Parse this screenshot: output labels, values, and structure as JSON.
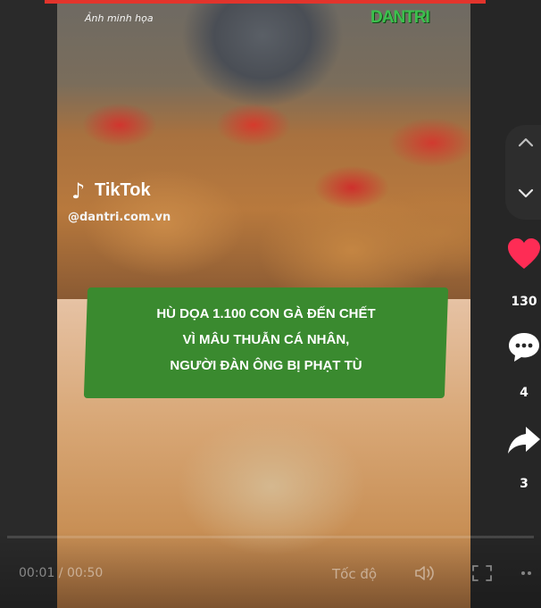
{
  "overlay": {
    "caption": "Ảnh minh họa",
    "brand": "DANTRI",
    "tiktok_note": "♪",
    "tiktok_word": "TikTok",
    "handle": "@dantri.com.vn"
  },
  "headline": {
    "lines": [
      "HÙ DỌA 1.100 CON GÀ ĐẾN CHẾT",
      "VÌ MÂU THUẪN CÁ NHÂN,",
      "NGƯỜI ĐÀN ÔNG BỊ PHẠT TÙ"
    ]
  },
  "actions": {
    "likes": "130",
    "comments": "4",
    "shares": "3"
  },
  "player": {
    "time": "00:01 / 00:50",
    "speed": "Tốc độ"
  },
  "colors": {
    "brand_green": "#3cc04d",
    "banner_green": "#3a8a2f",
    "like_red": "#fe2c55",
    "accent_red": "#e2342c"
  },
  "icons": {
    "nav_up": "chevron-up-icon",
    "nav_down": "chevron-down-icon",
    "like": "heart-icon",
    "comment": "comment-icon",
    "share": "share-icon",
    "volume": "volume-icon",
    "fullscreen": "fullscreen-icon",
    "more": "more-icon"
  }
}
